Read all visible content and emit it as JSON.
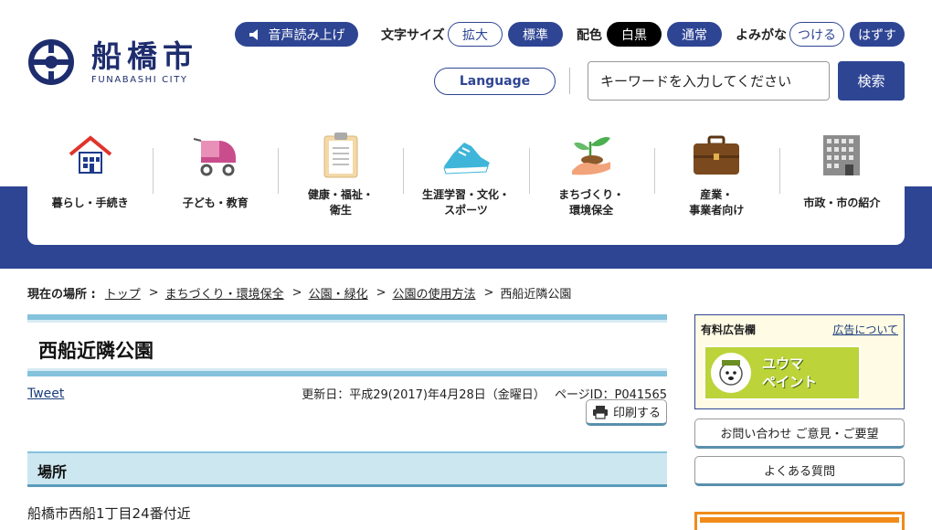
{
  "header": {
    "logo_kanji": "船橋市",
    "logo_roman": "FUNABASHI CITY",
    "read_aloud_label": "音声読み上げ",
    "text_size": {
      "label": "文字サイズ",
      "enlarge": "拡大",
      "standard": "標準"
    },
    "color_scheme": {
      "label": "配色",
      "white_black": "白黒",
      "normal": "通常"
    },
    "furigana": {
      "label": "よみがな",
      "on": "つける",
      "off": "はずす"
    },
    "language_label": "Language",
    "search": {
      "placeholder": "キーワードを入力してください",
      "button_label": "検索"
    }
  },
  "nav": {
    "items": [
      {
        "label": "暮らし・手続き",
        "icon": "house-icon"
      },
      {
        "label": "子ども・教育",
        "icon": "stroller-icon"
      },
      {
        "label": "健康・福祉・\n衛生",
        "icon": "clipboard-icon"
      },
      {
        "label": "生涯学習・文化・\nスポーツ",
        "icon": "sneaker-icon"
      },
      {
        "label": "まちづくり・\n環境保全",
        "icon": "sprout-icon"
      },
      {
        "label": "産業・\n事業者向け",
        "icon": "briefcase-icon"
      },
      {
        "label": "市政・市の紹介",
        "icon": "building-icon"
      }
    ]
  },
  "breadcrumb": {
    "label": "現在の場所 :",
    "links": [
      "トップ",
      "まちづくり・環境保全",
      "公園・緑化",
      "公園の使用方法"
    ],
    "current": "西船近隣公園"
  },
  "page": {
    "title": "西船近隣公園",
    "tweet": "Tweet",
    "updated": "更新日：平成29(2017)年4月28日（金曜日）",
    "page_id": "ページID：P041565",
    "print_label": "印刷する",
    "section_title": "場所",
    "location_text": "船橋市西船1丁目24番付近"
  },
  "sidebar": {
    "ad_label": "有料広告欄",
    "ad_about": "広告について",
    "ad_banner_line1": "ユウマ",
    "ad_banner_line2": "ペイント",
    "contact_label": "お問い合わせ ご意見・ご要望",
    "faq_label": "よくある質問"
  },
  "colors": {
    "brand_navy": "#2e4593",
    "accent_light_blue": "#85c2dc",
    "section_bg": "#cde7f1",
    "orange": "#f08b1a"
  }
}
